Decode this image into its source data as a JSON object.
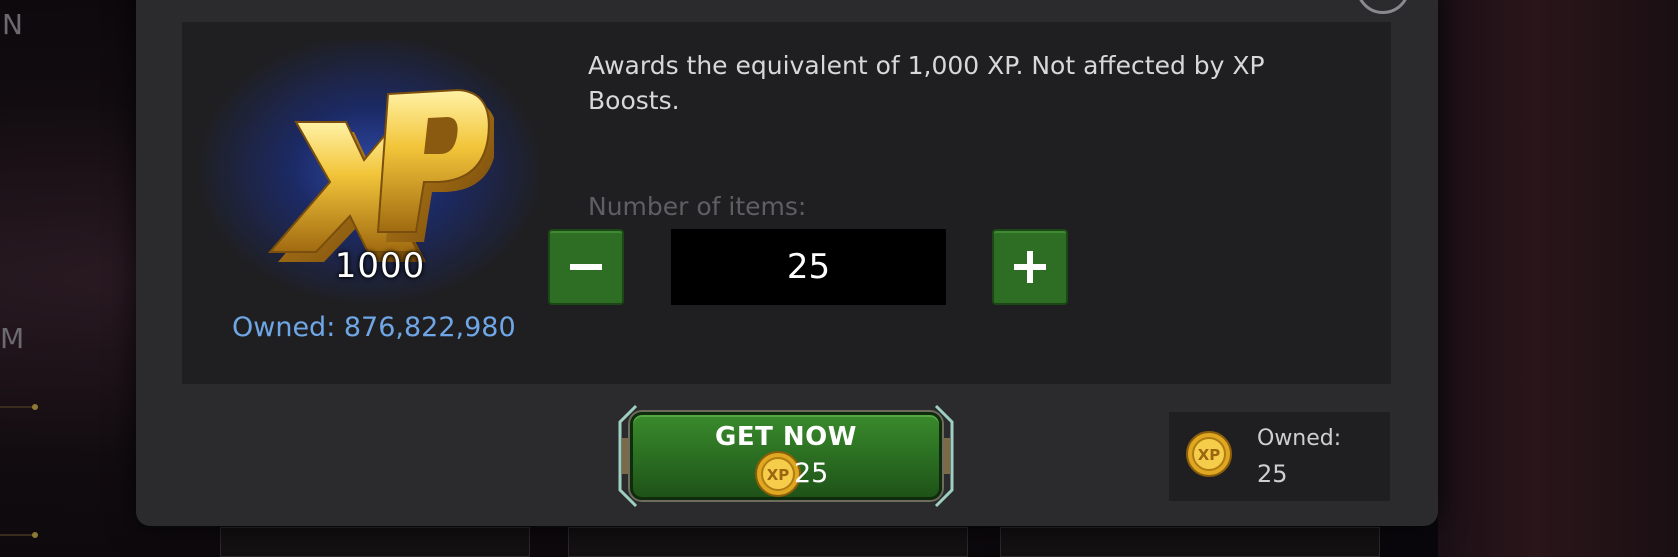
{
  "background": {
    "left_letters": [
      "N",
      "M"
    ]
  },
  "item": {
    "icon": "xp-1000-icon",
    "amount_label": "1000",
    "owned_total": "Owned: 876,822,980",
    "description": "Awards the equivalent of 1,000 XP. Not affected by XP Boosts."
  },
  "quantity": {
    "label": "Number of items:",
    "value": "25",
    "decrement_icon": "minus-icon",
    "increment_icon": "plus-icon"
  },
  "purchase": {
    "button_label": "GET NOW",
    "cost": "25",
    "currency_icon": "xp-coin-icon"
  },
  "currency_owned": {
    "label": "Owned:",
    "value": "25"
  },
  "colors": {
    "button_green": "#2d6e24",
    "owned_blue": "#6fa6e6",
    "panel": "#1f1f22",
    "modal": "#2b2b2e"
  }
}
